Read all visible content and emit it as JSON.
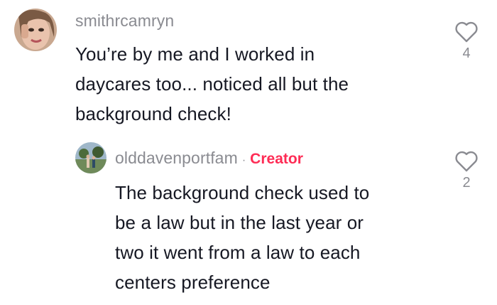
{
  "comments": [
    {
      "username": "smithrcamryn",
      "lines": [
        "You’re by me and I worked in",
        "daycares too... noticed all but the",
        "background check!"
      ],
      "likes": "4",
      "like_icon": "heart-outline-icon"
    },
    {
      "username": "olddavenportfam",
      "separator": "·",
      "badge": "Creator",
      "lines": [
        "The background check used to",
        "be a law but in the last year or",
        "two it went from a law to each",
        "centers preference"
      ],
      "likes": "2",
      "like_icon": "heart-outline-icon"
    }
  ],
  "colors": {
    "text": "#161823",
    "muted": "#8a8b91",
    "creator": "#fe2c55"
  }
}
